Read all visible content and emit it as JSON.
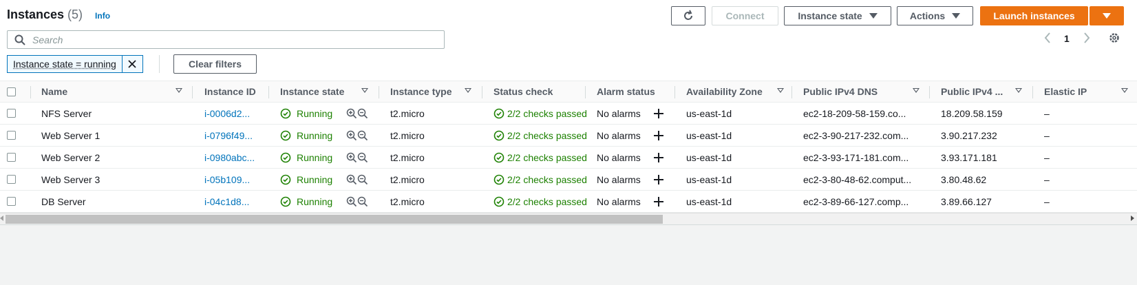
{
  "header": {
    "title": "Instances",
    "count": "(5)",
    "info": "Info"
  },
  "toolbar": {
    "connect": "Connect",
    "instance_state": "Instance state",
    "actions": "Actions",
    "launch": "Launch instances"
  },
  "search": {
    "placeholder": "Search"
  },
  "pagination": {
    "page": "1"
  },
  "filter": {
    "chip_label": "Instance state = running",
    "clear_label": "Clear filters"
  },
  "columns": [
    "Name",
    "Instance ID",
    "Instance state",
    "Instance type",
    "Status check",
    "Alarm status",
    "Availability Zone",
    "Public IPv4 DNS",
    "Public IPv4 ...",
    "Elastic IP"
  ],
  "rows": [
    {
      "name": "NFS Server",
      "id": "i-0006d2...",
      "state": "Running",
      "type": "t2.micro",
      "status": "2/2 checks passed",
      "alarm": "No alarms",
      "az": "us-east-1d",
      "dns": "ec2-18-209-58-159.co...",
      "ip": "18.209.58.159",
      "eip": "–"
    },
    {
      "name": "Web Server 1",
      "id": "i-0796f49...",
      "state": "Running",
      "type": "t2.micro",
      "status": "2/2 checks passed",
      "alarm": "No alarms",
      "az": "us-east-1d",
      "dns": "ec2-3-90-217-232.com...",
      "ip": "3.90.217.232",
      "eip": "–"
    },
    {
      "name": "Web Server 2",
      "id": "i-0980abc...",
      "state": "Running",
      "type": "t2.micro",
      "status": "2/2 checks passed",
      "alarm": "No alarms",
      "az": "us-east-1d",
      "dns": "ec2-3-93-171-181.com...",
      "ip": "3.93.171.181",
      "eip": "–"
    },
    {
      "name": "Web Server 3",
      "id": "i-05b109...",
      "state": "Running",
      "type": "t2.micro",
      "status": "2/2 checks passed",
      "alarm": "No alarms",
      "az": "us-east-1d",
      "dns": "ec2-3-80-48-62.comput...",
      "ip": "3.80.48.62",
      "eip": "–"
    },
    {
      "name": "DB Server",
      "id": "i-04c1d8...",
      "state": "Running",
      "type": "t2.micro",
      "status": "2/2 checks passed",
      "alarm": "No alarms",
      "az": "us-east-1d",
      "dns": "ec2-3-89-66-127.comp...",
      "ip": "3.89.66.127",
      "eip": "–"
    }
  ],
  "colors": {
    "accent": "#ec7211",
    "link": "#0073bb",
    "success": "#1d8102"
  }
}
